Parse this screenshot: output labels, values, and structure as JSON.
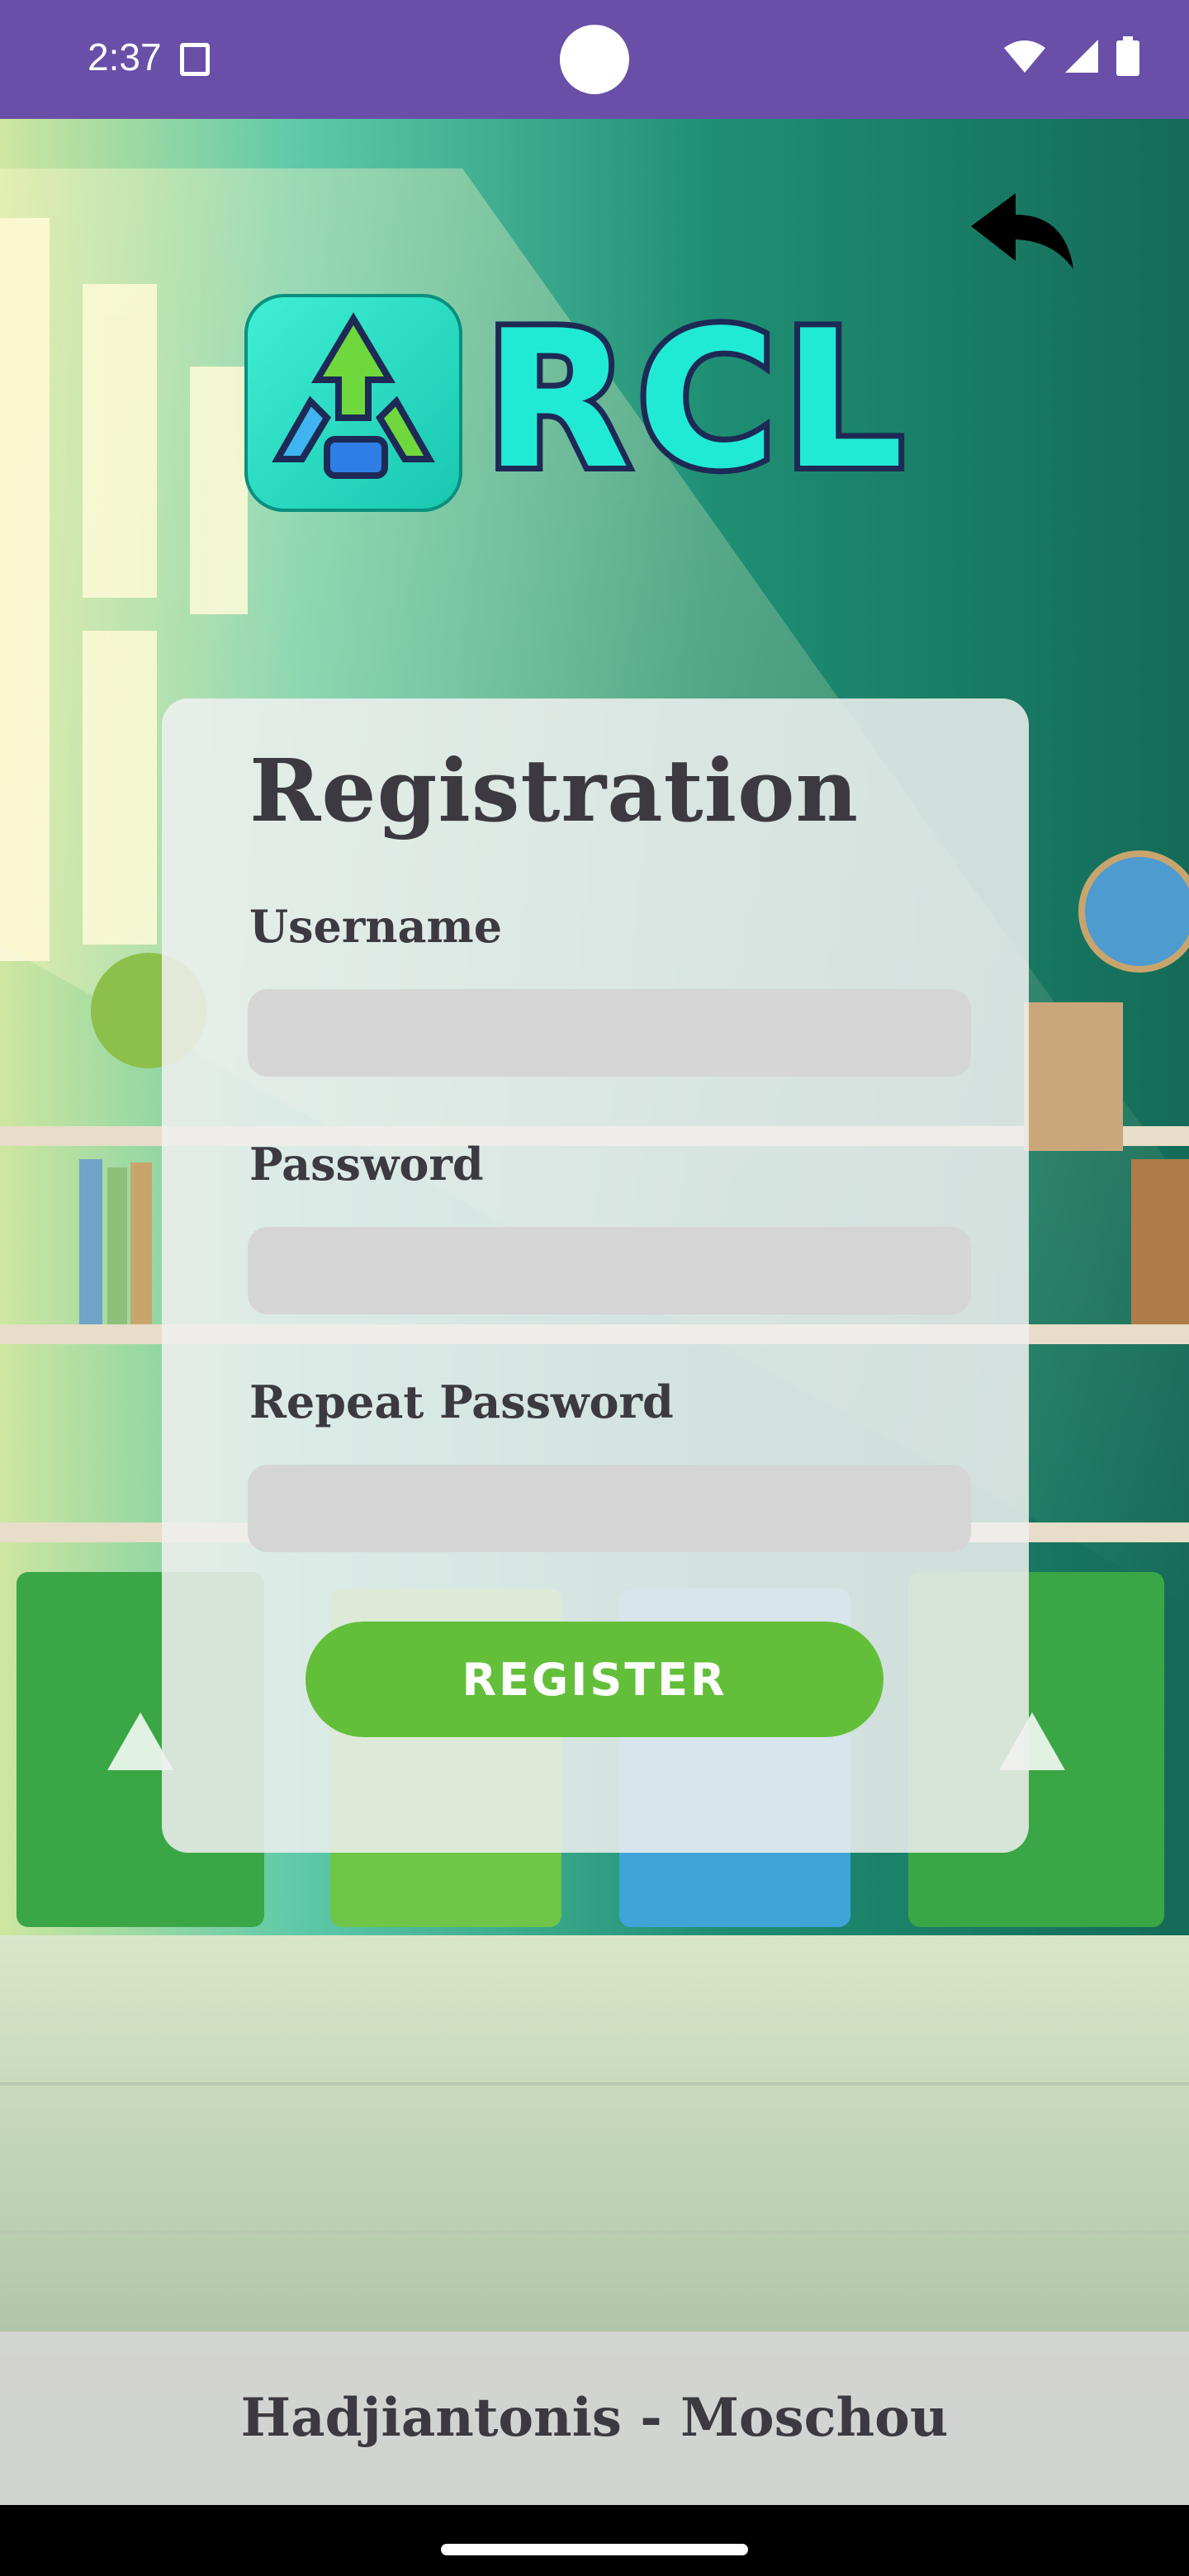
{
  "status_bar": {
    "time": "2:37",
    "icons": [
      "sim-card-icon",
      "wifi-icon",
      "cell-signal-icon",
      "battery-icon"
    ],
    "background_color": "#6a4fa8"
  },
  "header": {
    "back_icon": "back-arrow-icon",
    "logo": {
      "text": "RCL",
      "icon": "recycle-logo-icon",
      "text_color": "#21ead4"
    }
  },
  "form": {
    "title": "Registration",
    "fields": [
      {
        "label": "Username",
        "value": "",
        "placeholder": ""
      },
      {
        "label": "Password",
        "value": "",
        "placeholder": ""
      },
      {
        "label": "Repeat Password",
        "value": "",
        "placeholder": ""
      }
    ],
    "submit_label": "REGISTER",
    "button_color": "#63bf3a"
  },
  "footer": {
    "text": "Hadjiantonis - Moschou"
  }
}
